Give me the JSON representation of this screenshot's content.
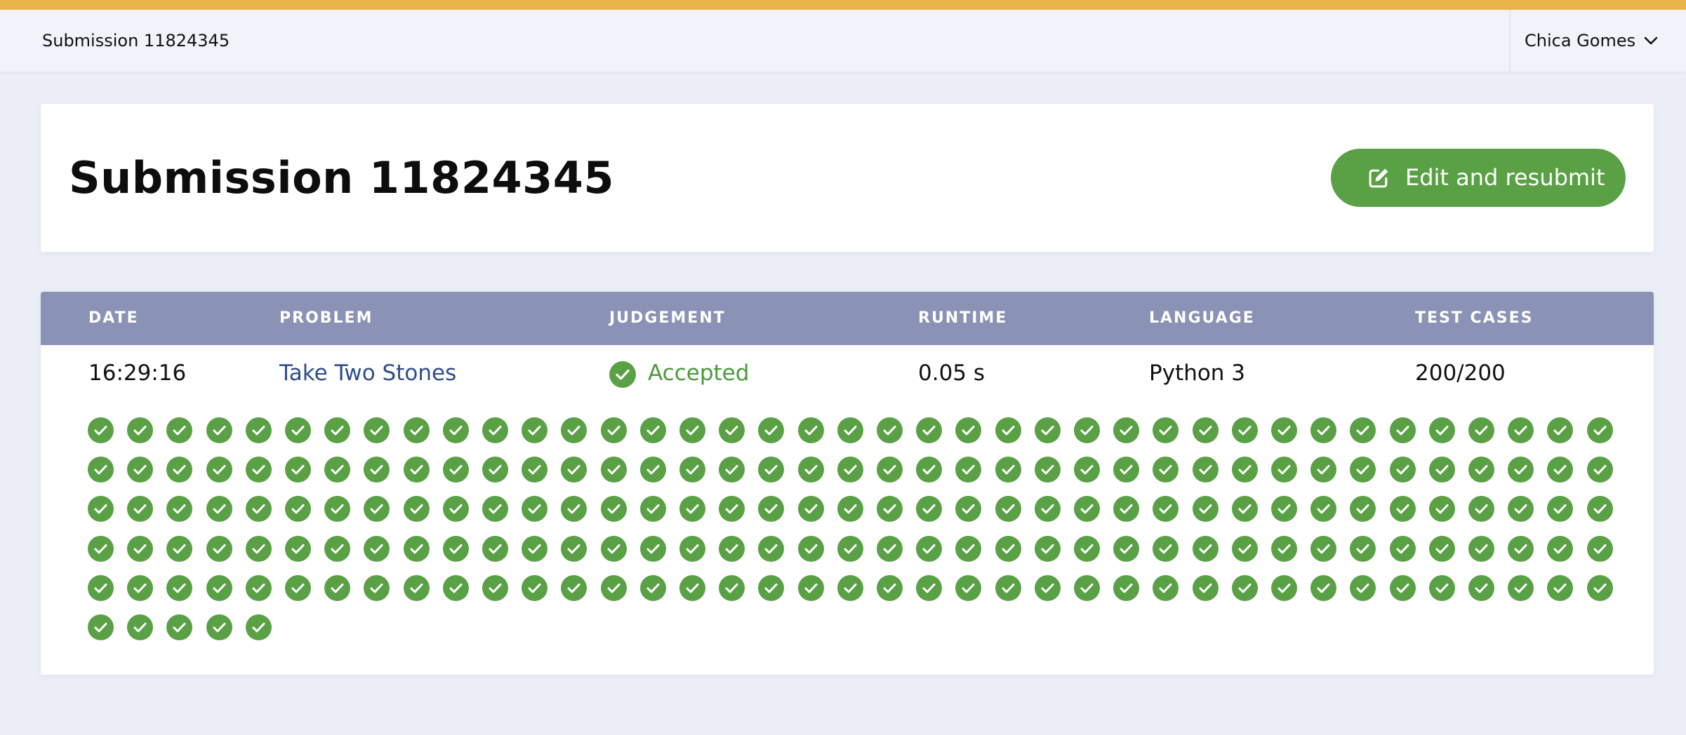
{
  "header": {
    "title": "Submission 11824345",
    "user_name": "Chica Gomes"
  },
  "submission": {
    "title": "Submission 11824345",
    "resubmit_label": "Edit and resubmit"
  },
  "table": {
    "headers": {
      "date": "DATE",
      "problem": "PROBLEM",
      "judgement": "JUDGEMENT",
      "runtime": "RUNTIME",
      "language": "LANGUAGE",
      "test_cases": "TEST CASES"
    },
    "row": {
      "date": "16:29:16",
      "problem": "Take Two Stones",
      "judgement": "Accepted",
      "runtime": "0.05 s",
      "language": "Python 3",
      "test_cases": "200/200"
    }
  },
  "test_cases": {
    "passed": 200,
    "total": 200,
    "status": "accepted"
  },
  "colors": {
    "accent_top_bar": "#e9b44c",
    "accepted_green": "#5aa146",
    "table_header": "#8a92b5",
    "link_blue": "#2f4d8a"
  },
  "icons": {
    "user_menu": "chevron-down-icon",
    "resubmit": "edit-icon",
    "judgement": "check-circle-icon",
    "test_case": "check-circle-icon"
  }
}
